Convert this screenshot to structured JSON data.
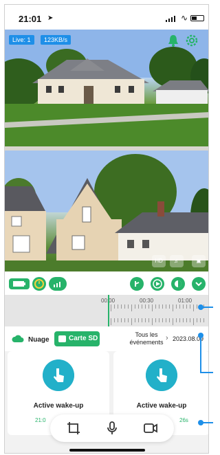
{
  "status_bar": {
    "time": "21:01",
    "location_icon": "location-arrow-icon",
    "signal_icon": "signal-icon",
    "wifi_icon": "wifi-icon",
    "battery_icon": "battery-icon"
  },
  "video_top": {
    "live_badge": "Live: 1",
    "rate_badge": "123KB/s"
  },
  "video_bottom": {
    "hd_label": "HD"
  },
  "timeline": {
    "labels": [
      "00:00",
      "00:30",
      "01:00"
    ]
  },
  "storage": {
    "cloud_label": "Nuage",
    "sd_label": "Carte SD",
    "events_label": "Tous les événements",
    "date": "2023.08.09"
  },
  "cards": [
    {
      "title": "Active wake-up",
      "time": "21:0",
      "duration": ""
    },
    {
      "title": "Active wake-up",
      "time": "",
      "duration": "26s"
    }
  ],
  "colors": {
    "accent": "#27b36a",
    "link": "#1e8fe8",
    "touch": "#22b0c9"
  }
}
